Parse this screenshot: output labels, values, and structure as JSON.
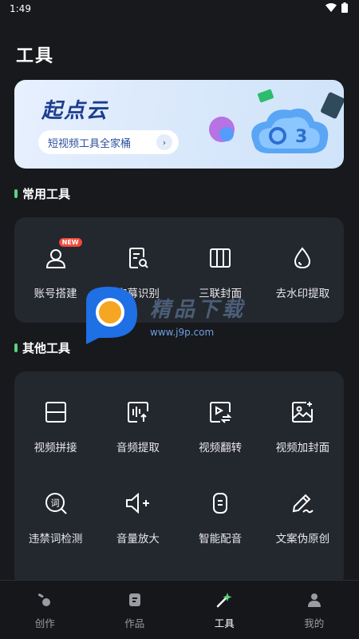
{
  "status": {
    "time": "1:49"
  },
  "page": {
    "title": "工具"
  },
  "banner": {
    "title": "起点云",
    "pill_text": "短视频工具全家桶",
    "pill_arrow": "›"
  },
  "common_tools": {
    "heading": "常用工具",
    "badge": "NEW",
    "items": [
      {
        "label": "账号搭建",
        "icon": "person-icon"
      },
      {
        "label": "字幕识别",
        "icon": "subtitle-doc-icon"
      },
      {
        "label": "三联封面",
        "icon": "triptych-icon"
      },
      {
        "label": "去水印提取",
        "icon": "droplet-icon"
      }
    ]
  },
  "other_tools": {
    "heading": "其他工具",
    "rows": [
      [
        {
          "label": "视频拼接",
          "icon": "split-frame-icon"
        },
        {
          "label": "音频提取",
          "icon": "audio-extract-icon"
        },
        {
          "label": "视频翻转",
          "icon": "video-flip-icon"
        },
        {
          "label": "视频加封面",
          "icon": "image-add-icon"
        }
      ],
      [
        {
          "label": "违禁词检测",
          "icon": "word-search-icon"
        },
        {
          "label": "音量放大",
          "icon": "volume-up-icon"
        },
        {
          "label": "智能配音",
          "icon": "dubbing-icon"
        },
        {
          "label": "文案伪原创",
          "icon": "pen-icon"
        }
      ]
    ]
  },
  "watermark": {
    "text": "精品下载",
    "url": "www.j9p.com"
  },
  "tabs": [
    {
      "label": "创作",
      "icon": "create-icon",
      "active": false
    },
    {
      "label": "作品",
      "icon": "works-icon",
      "active": false
    },
    {
      "label": "工具",
      "icon": "tools-sparkle-icon",
      "active": true
    },
    {
      "label": "我的",
      "icon": "profile-icon",
      "active": false
    }
  ],
  "colors": {
    "background": "#17191d",
    "card": "#23272e",
    "accent_green": "#57d67a",
    "banner_blue": "#1d3d8f"
  }
}
